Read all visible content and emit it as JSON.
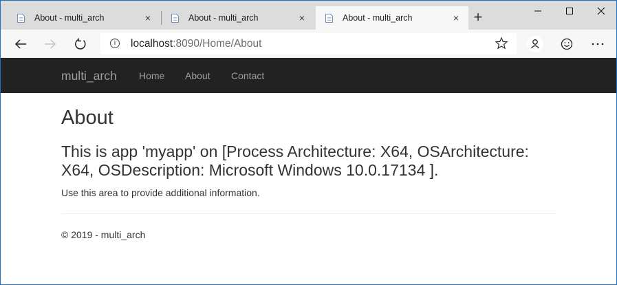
{
  "browser": {
    "tabs": [
      {
        "title": "About - multi_arch",
        "close": "×"
      },
      {
        "title": "About - multi_arch",
        "close": "×"
      },
      {
        "title": "About - multi_arch",
        "close": "×"
      }
    ],
    "new_tab": "+",
    "address": {
      "host": "localhost",
      "rest": ":8090/Home/About",
      "info": "i"
    },
    "icons": {
      "back": "back-arrow-icon",
      "forward": "forward-arrow-icon",
      "refresh": "refresh-icon",
      "favorite": "star-icon",
      "profile": "profile-icon",
      "feedback": "smiley-icon",
      "more": "more-icon",
      "minimize": "minimize-icon",
      "maximize": "maximize-icon",
      "close": "close-icon"
    },
    "colors": {
      "tabstrip": "#dcdcdc",
      "active_tab": "#f7f7f7",
      "frame_border": "#1a73c8"
    }
  },
  "site": {
    "brand": "multi_arch",
    "nav": [
      "Home",
      "About",
      "Contact"
    ],
    "navbar_color": "#222222",
    "nav_text_color": "#9d9d9d"
  },
  "main": {
    "title": "About",
    "message_line1": "This is app 'myapp' on [Process Architecture: X64, OSArchitecture:",
    "message_line2": "X64, OSDescription: Microsoft Windows 10.0.17134 ].",
    "info": "Use this area to provide additional information."
  },
  "footer": {
    "text": "© 2019 - multi_arch"
  }
}
